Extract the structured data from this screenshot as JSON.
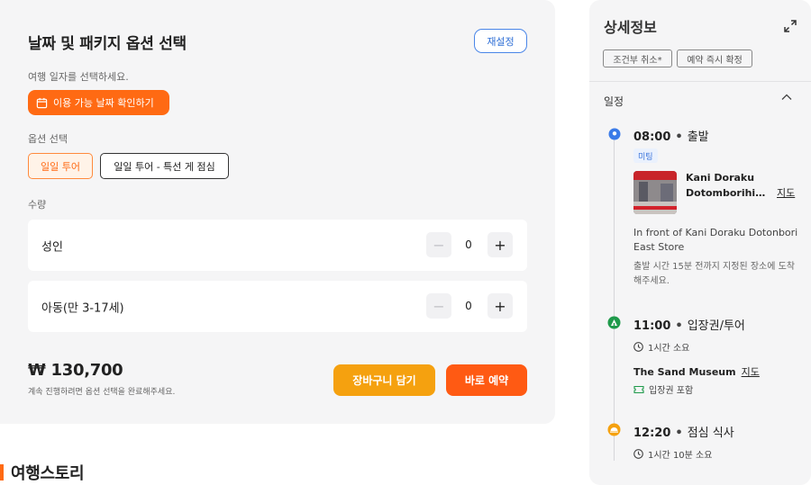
{
  "booking": {
    "title": "날짜 및 패키지 옵션 선택",
    "reset_label": "재설정",
    "date_prompt": "여행 일자를 선택하세요.",
    "date_button_label": "이용 가능 날짜 확인하기",
    "option_label": "옵션 선택",
    "options": [
      {
        "label": "일일 투어",
        "selected": true
      },
      {
        "label": "일일 투어 - 특선 게 점심",
        "selected": false
      }
    ],
    "quantity_label": "수량",
    "quantities": [
      {
        "name": "성인",
        "value": "0"
      },
      {
        "name": "아동(만 3-17세)",
        "value": "0"
      }
    ],
    "stepper_minus": "−",
    "stepper_plus": "+",
    "price": "₩ 130,700",
    "price_note": "계속 진행하려면 옵션 선택을 완료해주세요.",
    "cart_label": "장바구니 담기",
    "book_label": "바로 예약",
    "accent_color": "#ff6a13",
    "cart_color": "#f5a10f"
  },
  "story": {
    "title": "여행스토리"
  },
  "detail": {
    "title": "상세정보",
    "expand_icon": "expand-icon",
    "tags": [
      "조건부 취소*",
      "예약 즉시 확정"
    ],
    "itinerary_label": "일정",
    "steps": [
      {
        "time": "08:00",
        "sep": "•",
        "name": "출발",
        "icon": "location-pin-icon",
        "badge": "미팅",
        "place_name_1": "Kani Doraku",
        "place_name_2": "Dotomborihiga...",
        "map_label": "지도",
        "address": "In front of Kani Doraku Dotonbori East Store",
        "note": "출발 시간 15분 전까지 지정된 장소에 도착해주세요."
      },
      {
        "time": "11:00",
        "sep": "•",
        "name": "입장권/투어",
        "icon": "attraction-icon",
        "duration": "1시간 소요",
        "place_name": "The Sand Museum",
        "map_label": "지도",
        "ticket": "입장권 포함"
      },
      {
        "time": "12:20",
        "sep": "•",
        "name": "점심 식사",
        "icon": "meal-icon",
        "duration": "1시간 10분 소요"
      }
    ]
  }
}
